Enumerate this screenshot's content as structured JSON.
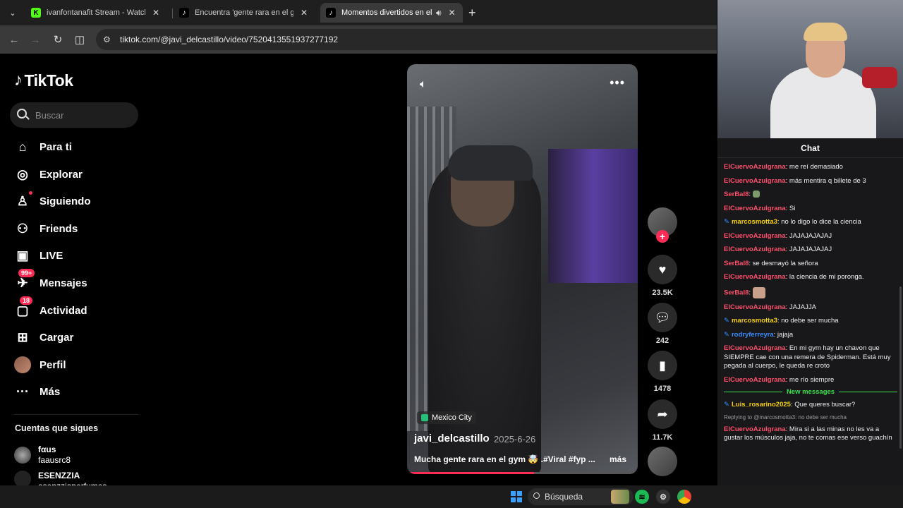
{
  "browser": {
    "tabs": [
      {
        "title": "ivanfontanafit Stream - Watch Live",
        "fav": "K",
        "favColor": "#53fc18"
      },
      {
        "title": "Encuentra 'gente rara en el gimnasio'",
        "fav": "♪",
        "favColor": "#000000"
      },
      {
        "title": "Momentos divertidos en el gym",
        "fav": "♪",
        "favColor": "#000000"
      }
    ],
    "url": "tiktok.com/@javi_delcastillo/video/7520413551937277192"
  },
  "tiktok": {
    "logo": "TikTok",
    "search_placeholder": "Buscar",
    "nav": [
      {
        "label": "Para ti",
        "icon": "⌂"
      },
      {
        "label": "Explorar",
        "icon": "◎"
      },
      {
        "label": "Siguiendo",
        "icon": "♙"
      },
      {
        "label": "Friends",
        "icon": "⚇"
      },
      {
        "label": "LIVE",
        "icon": "▣"
      },
      {
        "label": "Mensajes",
        "icon": "✈",
        "badge": "99+"
      },
      {
        "label": "Actividad",
        "icon": "▢",
        "badge": "18"
      },
      {
        "label": "Cargar",
        "icon": "⊞"
      },
      {
        "label": "Perfil",
        "icon": ""
      },
      {
        "label": "Más",
        "icon": "···"
      }
    ],
    "following_title": "Cuentas que sigues",
    "accounts": [
      {
        "name": "fαus",
        "handle": "faausrc8"
      },
      {
        "name": "ESENZZIA",
        "handle": "esenzziaperfumes"
      }
    ],
    "video": {
      "location": "Mexico City",
      "author": "javi_delcastillo",
      "date": "2025-6-26",
      "caption": "Mucha gente rara en el gym 🤯 .#Viral #fyp ...",
      "more": "más",
      "progress": 0.55
    },
    "actions": {
      "likes": "23.5K",
      "comments": "242",
      "saves": "1478",
      "shares": "11.7K"
    }
  },
  "taskbar": {
    "search": "Búsqueda"
  },
  "chat": {
    "title": "Chat",
    "new_messages": "New messages",
    "colors": {
      "red": "#ff4f6a",
      "yellow": "#f5d00f",
      "blue": "#3b8cff"
    },
    "messages_before": [
      {
        "user": "ElCuervoAzulgrana",
        "color": "red",
        "text": "me reí demasiado"
      },
      {
        "user": "ElCuervoAzulgrana",
        "color": "red",
        "text": "más mentira q billete de 3"
      },
      {
        "user": "SerBal8",
        "color": "red",
        "text": "",
        "emote": "small"
      },
      {
        "user": "ElCuervoAzulgrana",
        "color": "red",
        "text": "Si"
      },
      {
        "user": "marcosmotta3",
        "color": "yellow",
        "text": "no lo digo lo dice la ciencia",
        "badge": true
      },
      {
        "user": "ElCuervoAzulgrana",
        "color": "red",
        "text": "JAJAJAJAJAJ"
      },
      {
        "user": "ElCuervoAzulgrana",
        "color": "red",
        "text": "JAJAJAJAJAJ"
      },
      {
        "user": "SerBal8",
        "color": "red",
        "text": "se desmayó la señora"
      },
      {
        "user": "ElCuervoAzulgrana",
        "color": "red",
        "text": "la ciencia de mi poronga."
      },
      {
        "user": "SerBal8",
        "color": "red",
        "text": "",
        "emote": "big"
      },
      {
        "user": "ElCuervoAzulgrana",
        "color": "red",
        "text": "JAJAJJA"
      },
      {
        "user": "marcosmotta3",
        "color": "yellow",
        "text": "no debe ser mucha",
        "badge": true
      },
      {
        "user": "rodryferreyra",
        "color": "blue",
        "text": "jajaja",
        "badge": true
      },
      {
        "user": "ElCuervoAzulgrana",
        "color": "red",
        "text": "En mi gym hay un chavon que SIEMPRE cae con una remera de Spiderman. Está muy pegada al cuerpo, le queda re croto"
      },
      {
        "user": "ElCuervoAzulgrana",
        "color": "red",
        "text": "me río siempre"
      }
    ],
    "messages_after": [
      {
        "user": "Luis_rosarino2025",
        "color": "yellow",
        "text": "Que queres buscar?",
        "badge": true
      },
      {
        "reply": "Replying to @marcosmotta3: no debe ser mucha",
        "user": "ElCuervoAzulgrana",
        "color": "red",
        "text": "Mira si a las minas no les va a gustar los músculos jaja, no te comas ese verso guachín"
      }
    ]
  }
}
